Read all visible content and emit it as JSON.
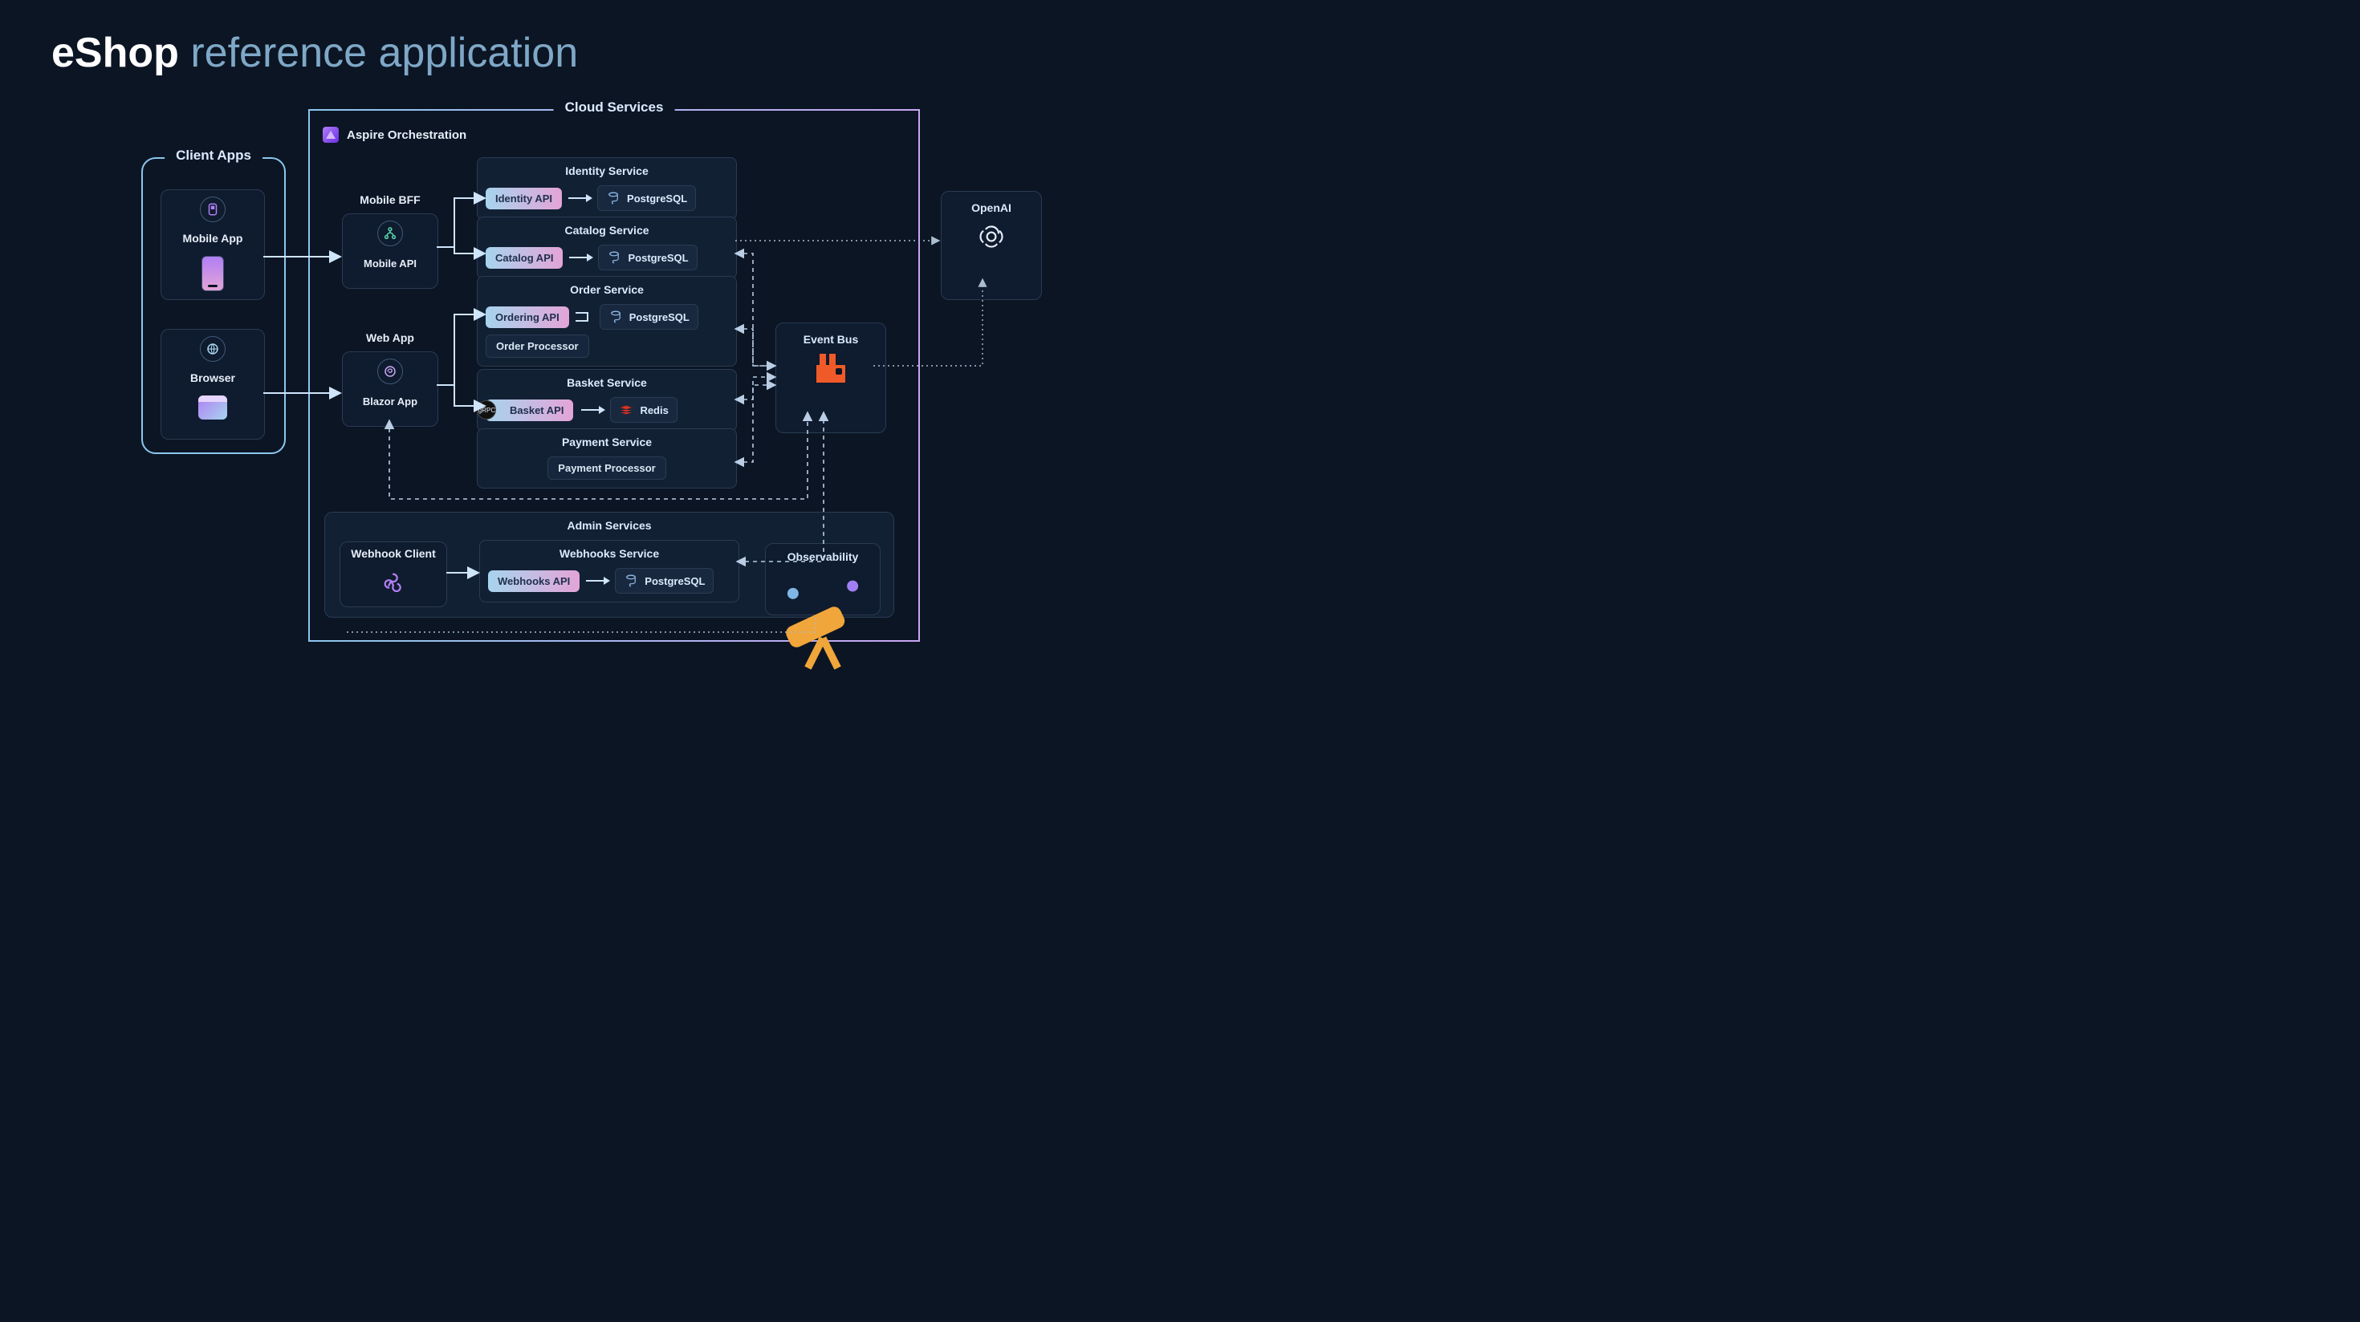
{
  "title": {
    "brand": "eShop",
    "suffix": "reference application"
  },
  "groups": {
    "client": "Client Apps",
    "cloud": "Cloud Services",
    "aspire": "Aspire Orchestration",
    "admin": "Admin Services"
  },
  "clients": {
    "mobileApp": "Mobile App",
    "browser": "Browser"
  },
  "bff": {
    "mobile": {
      "title": "Mobile BFF",
      "api": "Mobile API"
    },
    "web": {
      "title": "Web App",
      "app": "Blazor App"
    }
  },
  "services": {
    "identity": {
      "title": "Identity Service",
      "api": "Identity API",
      "db": "PostgreSQL"
    },
    "catalog": {
      "title": "Catalog Service",
      "api": "Catalog API",
      "db": "PostgreSQL"
    },
    "order": {
      "title": "Order Service",
      "api": "Ordering API",
      "processor": "Order Processor",
      "db": "PostgreSQL"
    },
    "basket": {
      "title": "Basket Service",
      "api": "Basket API",
      "store": "Redis",
      "protocol": "gRPC"
    },
    "payment": {
      "title": "Payment Service",
      "processor": "Payment Processor"
    },
    "webhooks": {
      "title": "Webhooks Service",
      "api": "Webhooks API",
      "db": "PostgreSQL"
    }
  },
  "infra": {
    "eventBus": "Event Bus",
    "openai": "OpenAI",
    "observability": "Observability",
    "webhookClient": "Webhook Client"
  },
  "icons": {
    "mobile": "mobile-app-icon",
    "browser": "globe-icon",
    "mobileApi": "usb/branch-icon",
    "blazor": "blazor-icon",
    "postgres": "postgresql-elephant-icon",
    "redis": "redis-icon",
    "rabbitmq": "rabbitmq-icon",
    "openai": "openai-logo-icon",
    "telescope": "telescope-icon",
    "webhook": "webhook-icon"
  },
  "connections": {
    "solid": [
      [
        "Mobile App",
        "Mobile API"
      ],
      [
        "Browser",
        "Blazor App"
      ],
      [
        "Mobile API",
        "Identity API"
      ],
      [
        "Mobile API",
        "Catalog API"
      ],
      [
        "Blazor App",
        "Ordering API"
      ],
      [
        "Blazor App",
        "Basket API"
      ],
      [
        "Webhook Client",
        "Webhooks API"
      ],
      [
        "Identity API",
        "PostgreSQL"
      ],
      [
        "Catalog API",
        "PostgreSQL"
      ],
      [
        "Ordering API",
        "PostgreSQL"
      ],
      [
        "Order Processor",
        "PostgreSQL"
      ],
      [
        "Basket API",
        "Redis"
      ],
      [
        "Webhooks API",
        "PostgreSQL"
      ]
    ],
    "dashed_bidirectional": [
      [
        "Catalog API",
        "Event Bus"
      ],
      [
        "Ordering API",
        "Event Bus"
      ],
      [
        "Basket Service",
        "Event Bus"
      ],
      [
        "Payment Processor",
        "Event Bus"
      ],
      [
        "Webhooks Service",
        "Event Bus"
      ],
      [
        "Blazor App",
        "Event Bus"
      ]
    ],
    "dotted": [
      [
        "Catalog API",
        "OpenAI"
      ],
      [
        "Event Bus",
        "OpenAI"
      ],
      [
        "Observability",
        "all services"
      ]
    ]
  }
}
